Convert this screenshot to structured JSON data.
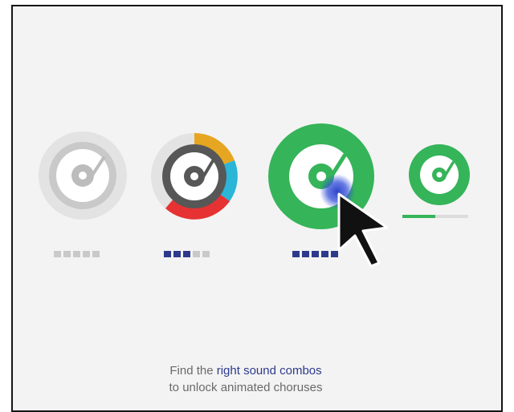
{
  "combos": [
    {
      "state": "locked",
      "colors": {
        "outer": "#e3e3e3",
        "ring": "#c7c7c7",
        "disc": "#bbbbbb"
      },
      "dots_filled": 0,
      "dots_total": 5
    },
    {
      "state": "partial",
      "colors": {
        "outer": "#e3e3e3",
        "disc": "#555555",
        "segments": [
          "#e7a622",
          "#2bb5d6",
          "#e63232"
        ]
      },
      "dots_filled": 3,
      "dots_total": 5
    },
    {
      "state": "selected",
      "colors": {
        "ring": "#35b459",
        "disc": "#35b459"
      },
      "dots_filled": 5,
      "dots_total": 5
    },
    {
      "state": "playing",
      "colors": {
        "ring": "#35b459",
        "disc": "#35b459"
      },
      "progress": 0.5
    }
  ],
  "caption": {
    "line1_prefix": "Find the ",
    "line1_highlight": "right sound combos",
    "line2": "to unlock animated choruses"
  },
  "colors": {
    "accent_blue": "#2d3a8c",
    "green": "#35b459"
  }
}
